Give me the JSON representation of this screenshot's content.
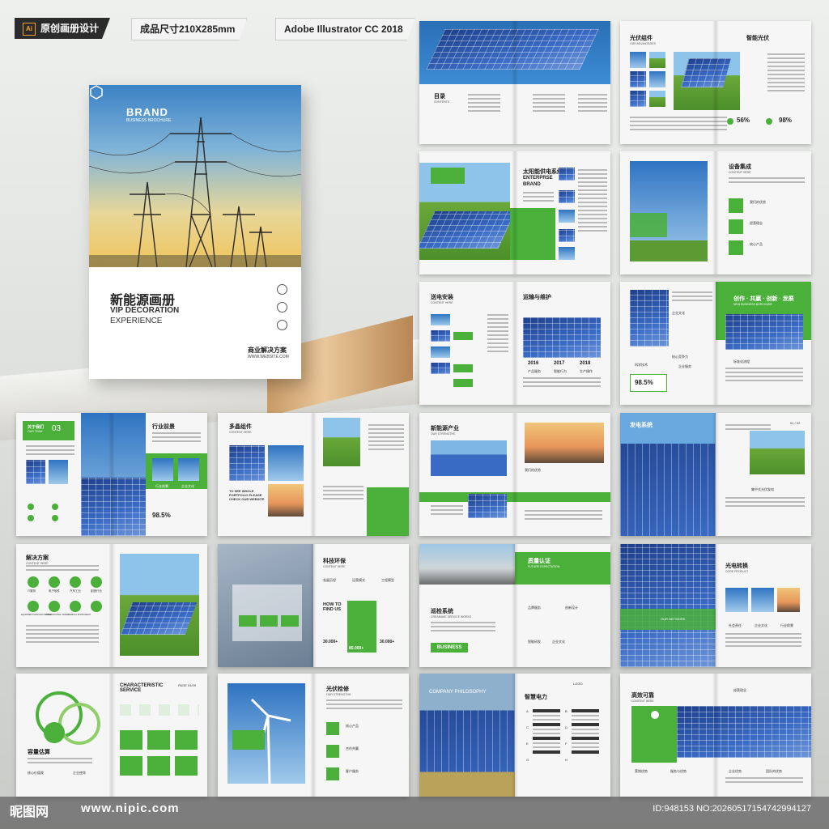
{
  "tags": {
    "original": "原创画册设计",
    "size": "成品尺寸210X285mm",
    "software": "Adobe Illustrator CC 2018",
    "ai_badge": "Ai"
  },
  "cover": {
    "brand": "BRAND",
    "brand_sub": "BUSINESS BROCHURE",
    "title": "新能源画册",
    "subtitle1": "VIP DECORATION",
    "subtitle2": "EXPERIENCE",
    "biz": "商业解决方案",
    "website": "WWW.WEBSITE.COM"
  },
  "spreads": {
    "s1": {
      "title": "目录",
      "sub": "CONTENTS"
    },
    "s2": {
      "title1": "光伏组件",
      "sub1": "OUR ADVANTAGES",
      "title2": "智能光伏",
      "stat1": "56%",
      "stat2": "98%"
    },
    "s3": {
      "title": "太阳能供电系统",
      "en1": "ENTERPRSE",
      "en2": "BRAND",
      "small": "我们的优势"
    },
    "s4": {
      "title": "设备集成",
      "sub": "CONTENT HERE",
      "items": [
        "我们的优势",
        "经营理念",
        "核心产品"
      ]
    },
    "s5": {
      "title1": "送电安装",
      "sub1": "CONTENT HERE",
      "title2": "运输与维护",
      "years": [
        "2016",
        "2017",
        "2018"
      ],
      "yl": [
        "产品服务",
        "智能行为",
        "生产操作"
      ]
    },
    "s6": {
      "slogan": "创作 · 共赢 · 创新 · 发展",
      "slogan_en": "NEW BUSINESS BORCHURE",
      "stat": "98.5%",
      "items": [
        "企业文化",
        "核心竞争力",
        "标准化流程",
        "科学技术",
        "企业服务"
      ]
    },
    "s7": {
      "num": "03",
      "label": "关于我们",
      "sub": "OUR TEAM",
      "title": "行业前景",
      "stat": "98.5%",
      "items": [
        "行业前景",
        "企业文化"
      ]
    },
    "s8": {
      "title": "多晶组件",
      "sub": "CONTENT HERE",
      "note": "TO SEE WHOLE PORTFOLIO PLEASE CHECK OUR WEBSITE"
    },
    "s9": {
      "title": "新能源产业",
      "sub": "OUR STRENGTHS",
      "small": "我们的优势"
    },
    "s10": {
      "title": "发电系统",
      "page": "01 / 02",
      "small": "集中式光伏发电"
    },
    "s11": {
      "title": "解决方案",
      "sub": "CONTENT HERE",
      "icons": [
        "IT服务",
        "电子软件",
        "汽车工业",
        "制造行业",
        "EQUIPMENT MANUFACTURING",
        "INTERNATIONAL TRADE",
        "MEDICAL INSTRUMENT"
      ]
    },
    "s12": {
      "title": "科技环保",
      "sub": "CONTENT HERE",
      "how": "HOW TO FIND US",
      "s1": "30.000+",
      "s2": "85.000+",
      "s3": "30.000+",
      "labels": [
        "发展历程",
        "运营模式",
        "工程模型"
      ]
    },
    "s13": {
      "title1": "质量认证",
      "sub1": "FUTURE EXPECTATION",
      "title2": "巡检系统",
      "sub2": "CREAMAKE SERVICE WORKS",
      "badge": "BUSINESS",
      "items": [
        "品牌服务",
        "创新设计",
        "智能研发",
        "企业文化"
      ]
    },
    "s14": {
      "title": "光电转换",
      "sub": "CORE PRODUCT",
      "net": "OUR NETWORK",
      "items": [
        "社会责任",
        "企业文化",
        "行业前景"
      ]
    },
    "s15": {
      "title": "容量估算",
      "title2": "CHARACTERISTIC SERVICE",
      "page": "PAGE 01/09",
      "items": [
        "核心价值观",
        "企业使命"
      ]
    },
    "s16": {
      "title": "光伏检修",
      "sub": "OUR STRENGTHS",
      "items": [
        "核心产品",
        "合作共赢",
        "客户服务"
      ]
    },
    "s17": {
      "title": "智慧电力",
      "en": "COMPANY PHILOSOPHY",
      "logo": "LOGO",
      "letters": [
        "A",
        "B",
        "C",
        "D",
        "E",
        "F",
        "G",
        "H"
      ]
    },
    "s18": {
      "title": "高效可靠",
      "sub": "CONTENT HERE",
      "items": [
        "经营理念",
        "营销优势",
        "服务与优势",
        "企业优势",
        "团队的优势"
      ]
    }
  },
  "watermark": {
    "logo": "昵图网",
    "url": "www.nipic.com",
    "id": "ID:948153 NO:20260517154742994127"
  }
}
